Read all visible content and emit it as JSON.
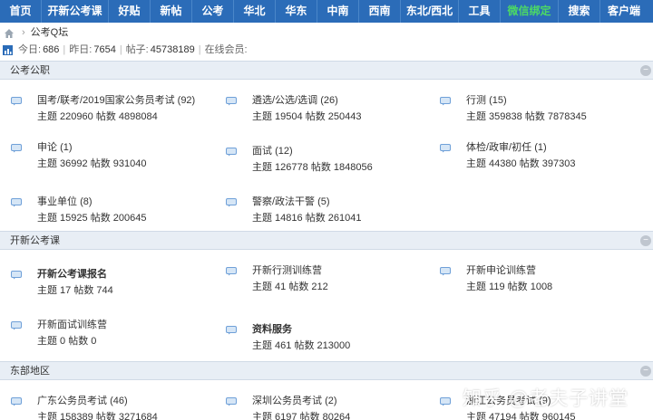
{
  "nav": {
    "items": [
      {
        "label": "首页",
        "accent": false
      },
      {
        "label": "开新公考课",
        "accent": false
      },
      {
        "label": "好贴",
        "accent": false
      },
      {
        "label": "新帖",
        "accent": false
      },
      {
        "label": "公考",
        "accent": false
      },
      {
        "label": "华北",
        "accent": false
      },
      {
        "label": "华东",
        "accent": false
      },
      {
        "label": "中南",
        "accent": false
      },
      {
        "label": "西南",
        "accent": false
      },
      {
        "label": "东北/西北",
        "accent": false
      },
      {
        "label": "工具",
        "accent": false
      },
      {
        "label": "微信绑定",
        "accent": true
      },
      {
        "label": "搜索",
        "accent": false
      },
      {
        "label": "客户端",
        "accent": false
      }
    ],
    "background": "#2b6cb8",
    "accent_color": "#4cd964"
  },
  "breadcrumb": {
    "home_icon": "home-icon",
    "separator": "›",
    "current": "公考Q坛"
  },
  "stats": {
    "today_label": "今日:",
    "today": "686",
    "yesterday_label": "昨日:",
    "yesterday": "7654",
    "posts_label": "帖子:",
    "posts": "45738189",
    "online_label": "在线会员:"
  },
  "sections": [
    {
      "title": "公考公职",
      "forums": [
        {
          "name": "国考/联考/2019国家公务员考试",
          "today": "(92)",
          "meta": "主题 220960 帖数 4898084",
          "bold": false
        },
        {
          "name": "遴选/公选/选调",
          "today": "(26)",
          "meta": "主题 19504 帖数 250443",
          "bold": false
        },
        {
          "name": "行测",
          "today": "(15)",
          "meta": "主题 359838 帖数 7878345",
          "bold": false
        },
        {
          "name": "申论",
          "today": "(1)",
          "meta": "主题 36992 帖数 931040",
          "bold": false
        },
        {
          "name": "面试",
          "today": "(12)",
          "meta": "主题 126778 帖数 1848056",
          "bold": false
        },
        {
          "name": "体检/政审/初任",
          "today": "(1)",
          "meta": "主题 44380 帖数 397303",
          "bold": false
        },
        {
          "name": "事业单位",
          "today": "(8)",
          "meta": "主题 15925 帖数 200645",
          "bold": false
        },
        {
          "name": "警察/政法干警",
          "today": "(5)",
          "meta": "主题 14816 帖数 261041",
          "bold": false
        }
      ]
    },
    {
      "title": "开新公考课",
      "forums": [
        {
          "name": "开新公考课报名",
          "today": "",
          "meta": "主题 17 帖数 744",
          "bold": true
        },
        {
          "name": "开新行测训练营",
          "today": "",
          "meta": "主题 41 帖数 212",
          "bold": false
        },
        {
          "name": "开新申论训练营",
          "today": "",
          "meta": "主题 119 帖数 1008",
          "bold": false
        },
        {
          "name": "开新面试训练营",
          "today": "",
          "meta": "主题 0 帖数 0",
          "bold": false
        },
        {
          "name": "资料服务",
          "today": "",
          "meta": "主题 461 帖数 213000",
          "bold": false
        }
      ]
    },
    {
      "title": "东部地区",
      "forums": [
        {
          "name": "广东公务员考试",
          "today": "(46)",
          "meta": "主题 158389 帖数 3271684",
          "bold": false
        },
        {
          "name": "深圳公务员考试",
          "today": "(2)",
          "meta": "主题 6197 帖数 80264",
          "bold": false
        },
        {
          "name": "浙江公务员考试",
          "today": "(9)",
          "meta": "主题 47194 帖数 960145",
          "bold": false
        }
      ]
    }
  ],
  "watermark": "知乎 @老夫子讲堂",
  "colors": {
    "section_header_bg": "#e8eef5",
    "icon_blue": "#6fa0d8"
  }
}
